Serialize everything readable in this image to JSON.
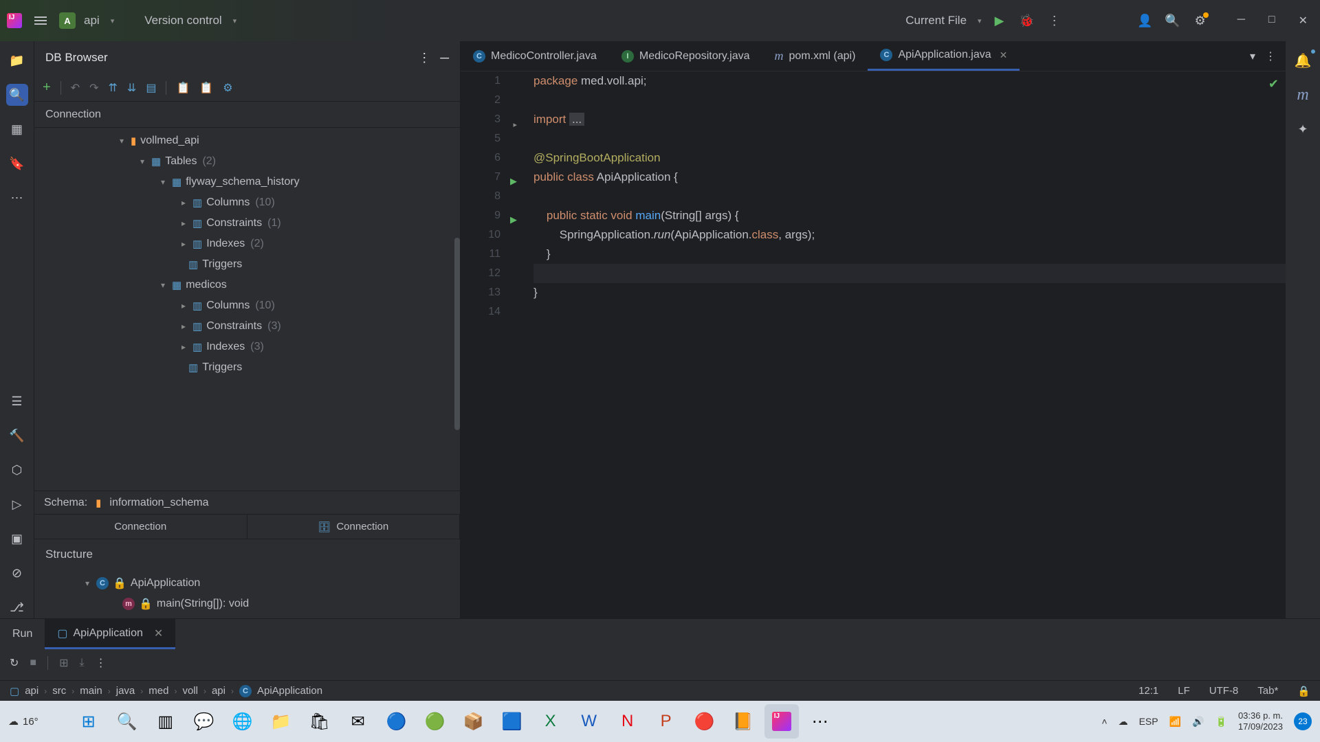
{
  "titlebar": {
    "project": "api",
    "vcs": "Version control",
    "runconfig": "Current File"
  },
  "db_browser": {
    "title": "DB Browser",
    "connection_label": "Connection",
    "root": "vollmed_api",
    "tables_label": "Tables",
    "tables_count": "(2)",
    "table1": "flyway_schema_history",
    "table2": "medicos",
    "columns_label": "Columns",
    "columns_count": "(10)",
    "constraints_label": "Constraints",
    "constraints1_count": "(1)",
    "constraints2_count": "(3)",
    "indexes_label": "Indexes",
    "indexes1_count": "(2)",
    "indexes2_count": "(3)",
    "triggers_label": "Triggers",
    "schema_label": "Schema:",
    "schema_value": "information_schema",
    "conn_tab1": "Connection",
    "conn_tab2": "Connection"
  },
  "structure": {
    "title": "Structure",
    "class": "ApiApplication",
    "method": "main(String[]): void"
  },
  "tabs": {
    "t1": "MedicoController.java",
    "t2": "MedicoRepository.java",
    "t3": "pom.xml (api)",
    "t4": "ApiApplication.java"
  },
  "code": {
    "l1": "package med.voll.api;",
    "l3a": "import ",
    "l3b": "...",
    "l6": "@SpringBootApplication",
    "l7a": "public class ",
    "l7b": "ApiApplication {",
    "l9a": "    public static void ",
    "l9b": "main",
    "l9c": "(String[] args) {",
    "l10a": "        SpringApplication.",
    "l10b": "run",
    "l10c": "(ApiApplication.",
    "l10d": "class",
    "l10e": ", args);",
    "l11": "    }",
    "l13": "}"
  },
  "run": {
    "label": "Run",
    "tab": "ApiApplication"
  },
  "breadcrumb": {
    "p1": "api",
    "p2": "src",
    "p3": "main",
    "p4": "java",
    "p5": "med",
    "p6": "voll",
    "p7": "api",
    "p8": "ApiApplication"
  },
  "status": {
    "pos": "12:1",
    "sep": "LF",
    "enc": "UTF-8",
    "indent": "Tab*"
  },
  "taskbar": {
    "weather": "16°",
    "lang": "ESP",
    "time": "03:36 p. m.",
    "date": "17/09/2023",
    "badge": "23"
  }
}
